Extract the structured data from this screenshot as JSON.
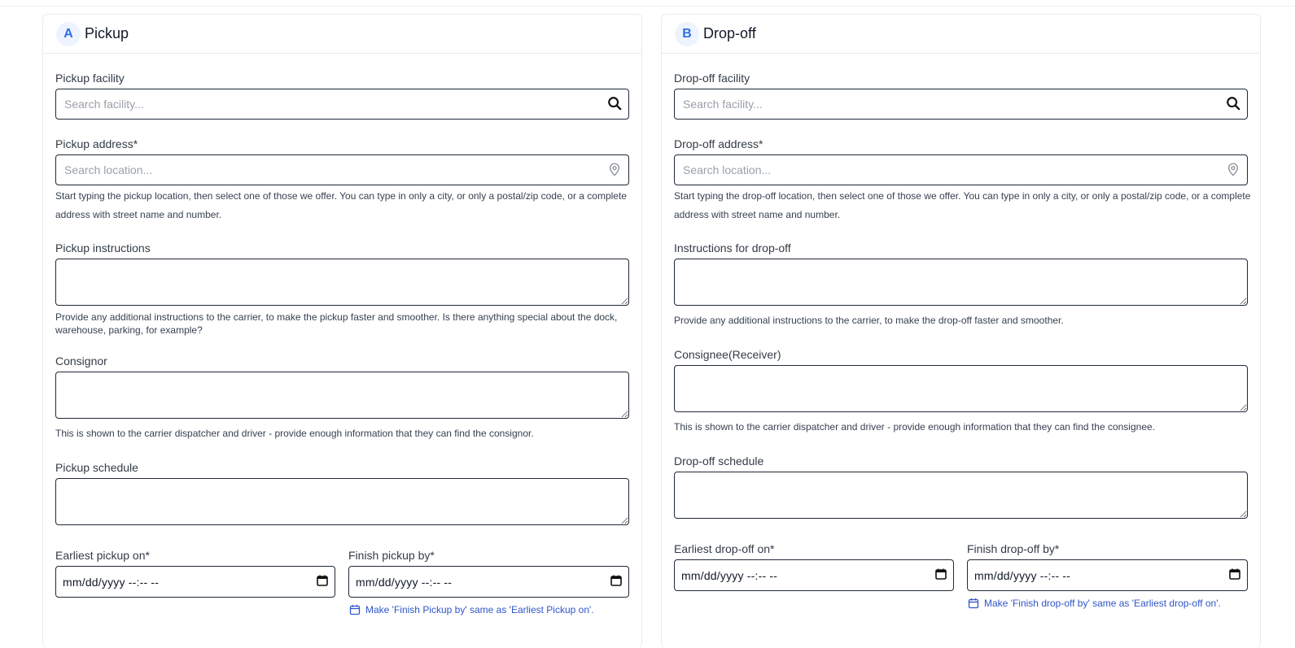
{
  "pickup": {
    "badge": "A",
    "title": "Pickup",
    "facility_label": "Pickup facility",
    "facility_placeholder": "Search facility...",
    "address_label": "Pickup address*",
    "address_placeholder": "Search location...",
    "address_help_1": "Start typing the pickup location, then select one of those we offer. You can type in only a city, or only a postal/zip code, or a complete",
    "address_help_2": "address with street name and number.",
    "instructions_label": "Pickup instructions",
    "instructions_help_1": "Provide any additional instructions to the carrier, to make the pickup faster and smoother. Is there anything special about the dock,",
    "instructions_help_2": "warehouse, parking, for example?",
    "party_label": "Consignor",
    "party_help": "This is shown to the carrier dispatcher and driver - provide enough information that they can find the consignor.",
    "schedule_label": "Pickup schedule",
    "earliest_label": "Earliest pickup on*",
    "finish_label": "Finish pickup by*",
    "date_placeholder": "mm/dd/yyyy --:-- --",
    "same_link": "Make 'Finish Pickup by' same as 'Earliest Pickup on'."
  },
  "dropoff": {
    "badge": "B",
    "title": "Drop-off",
    "facility_label": "Drop-off facility",
    "facility_placeholder": "Search facility...",
    "address_label": "Drop-off address*",
    "address_placeholder": "Search location...",
    "address_help_1": "Start typing the drop-off location, then select one of those we offer. You can type in only a city, or only a postal/zip code, or a complete",
    "address_help_2": "address with street name and number.",
    "instructions_label": "Instructions for drop-off",
    "instructions_help_1": "Provide any additional instructions to the carrier, to make the drop-off faster and smoother.",
    "party_label": "Consignee(Receiver)",
    "party_help": "This is shown to the carrier dispatcher and driver - provide enough information that they can find the consignee.",
    "schedule_label": "Drop-off schedule",
    "earliest_label": "Earliest drop-off on*",
    "finish_label": "Finish drop-off by*",
    "date_placeholder": "mm/dd/yyyy --:-- --",
    "same_link": "Make 'Finish drop-off by' same as 'Earliest drop-off on'."
  },
  "icons": {
    "search": "magnifier-icon",
    "location": "map-pin-icon",
    "calendar": "calendar-icon"
  },
  "colors": {
    "accent": "#2f6fe4",
    "link": "#2f56c8",
    "badge_bg": "#eef4ff"
  }
}
